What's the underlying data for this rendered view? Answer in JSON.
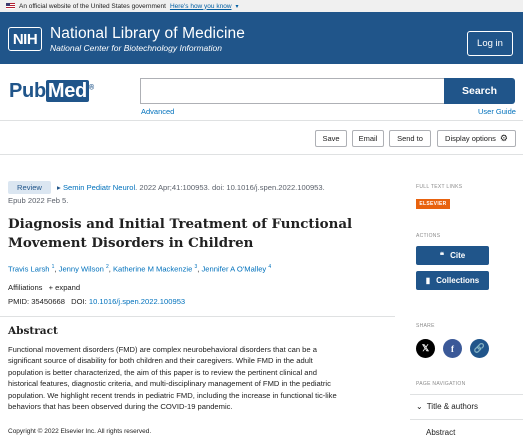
{
  "gov_banner": {
    "text": "An official website of the United States government",
    "link": "Here's how you know"
  },
  "header": {
    "logo": "NIH",
    "title": "National Library of Medicine",
    "subtitle": "National Center for Biotechnology Information",
    "login": "Log in"
  },
  "search": {
    "logo_pub": "Pub",
    "logo_med": "Med",
    "logo_reg": "®",
    "placeholder": "",
    "button": "Search",
    "advanced": "Advanced",
    "guide": "User Guide"
  },
  "toolbar": {
    "save": "Save",
    "email": "Email",
    "send_to": "Send to",
    "display": "Display options"
  },
  "article": {
    "type": "Review",
    "journal": "Semin Pediatr Neurol",
    "citation": ". 2022 Apr;41:100953. doi: 10.1016/j.spen.2022.100953.",
    "epub": "Epub 2022 Feb 5.",
    "title": "Diagnosis and Initial Treatment of Functional Movement Disorders in Children",
    "authors": [
      {
        "name": "Travis Larsh",
        "sup": "1"
      },
      {
        "name": "Jenny Wilson",
        "sup": "2"
      },
      {
        "name": "Katherine M Mackenzie",
        "sup": "3"
      },
      {
        "name": "Jennifer A O'Malley",
        "sup": "4"
      }
    ],
    "affiliations": "Affiliations",
    "expand": "expand",
    "pmid_label": "PMID: 35450668",
    "doi_label": "DOI:",
    "doi": "10.1016/j.spen.2022.100953",
    "abstract_heading": "Abstract",
    "abstract_lines": [
      "Functional movement disorders (FMD) are complex neurobehavioral disorders that can be a",
      "significant source of disability for both children and their caregivers. While FMD in the adult",
      "population is better characterized, the aim of this paper is to review the pertinent clinical and",
      "historical features, diagnostic criteria, and multi-disciplinary management of FMD in the pediatric",
      "population. We highlight recent trends in pediatric FMD, including the increase in functional tic-like",
      "behaviors that has been observed during the COVID-19 pandemic."
    ],
    "copyright": "Copyright © 2022 Elsevier Inc. All rights reserved."
  },
  "sidebar": {
    "full_text_label": "FULL TEXT LINKS",
    "elsevier": "ELSEVIER",
    "actions_label": "ACTIONS",
    "cite": "Cite",
    "collections": "Collections",
    "share_label": "SHARE",
    "page_nav_label": "PAGE NAVIGATION",
    "nav_title": "Title & authors",
    "nav_abstract": "Abstract"
  },
  "colors": {
    "brand": "#20558a",
    "link": "#0071bc",
    "elsevier": "#e8620e",
    "facebook": "#3b5998",
    "x": "#000000"
  }
}
